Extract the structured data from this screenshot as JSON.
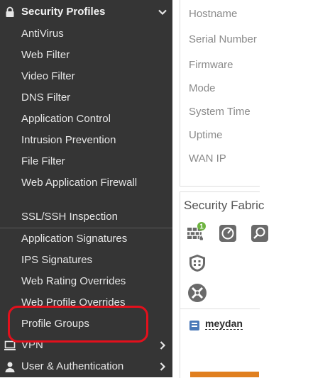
{
  "sidebar": {
    "group_title": "Security Profiles",
    "items": [
      {
        "label": "AntiVirus"
      },
      {
        "label": "Web Filter"
      },
      {
        "label": "Video Filter"
      },
      {
        "label": "DNS Filter"
      },
      {
        "label": "Application Control"
      },
      {
        "label": "Intrusion Prevention"
      },
      {
        "label": "File Filter"
      },
      {
        "label": "Web Application Firewall"
      },
      {
        "label": "SSL/SSH Inspection"
      },
      {
        "label": "Application Signatures"
      },
      {
        "label": "IPS Signatures"
      },
      {
        "label": "Web Rating Overrides"
      },
      {
        "label": "Web Profile Overrides"
      },
      {
        "label": "Profile Groups"
      }
    ],
    "bottom": [
      {
        "label": "VPN",
        "icon": "monitor-icon"
      },
      {
        "label": "User & Authentication",
        "icon": "user-icon"
      }
    ]
  },
  "system_info": {
    "labels": [
      "Hostname",
      "Serial Number",
      "Firmware",
      "Mode",
      "System Time",
      "Uptime",
      "WAN IP"
    ]
  },
  "security_fabric": {
    "title": "Security Fabric",
    "badge_count": "1",
    "device_name": "meydan"
  },
  "colors": {
    "sidebar_bg": "#353535",
    "highlight": "#e3101c",
    "badge": "#6db33f",
    "accent_orange": "#e07f1f"
  }
}
